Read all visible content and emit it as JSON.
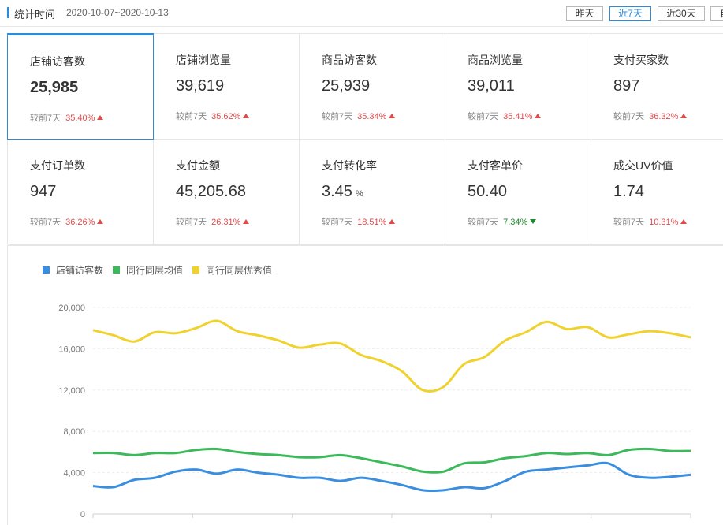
{
  "header": {
    "title": "统计时间",
    "date_range": "2020-10-07~2020-10-13",
    "buttons": [
      {
        "label": "昨天",
        "active": false
      },
      {
        "label": "近7天",
        "active": true
      },
      {
        "label": "近30天",
        "active": false
      },
      {
        "label": "自",
        "active": false
      }
    ]
  },
  "metrics": [
    {
      "label": "店铺访客数",
      "value": "25,985",
      "compare_label": "较前7天",
      "pct": "35.40%",
      "direction": "up",
      "selected": true
    },
    {
      "label": "店铺浏览量",
      "value": "39,619",
      "compare_label": "较前7天",
      "pct": "35.62%",
      "direction": "up"
    },
    {
      "label": "商品访客数",
      "value": "25,939",
      "compare_label": "较前7天",
      "pct": "35.34%",
      "direction": "up"
    },
    {
      "label": "商品浏览量",
      "value": "39,011",
      "compare_label": "较前7天",
      "pct": "35.41%",
      "direction": "up"
    },
    {
      "label": "支付买家数",
      "value": "897",
      "compare_label": "较前7天",
      "pct": "36.32%",
      "direction": "up"
    },
    {
      "label": "支付订单数",
      "value": "947",
      "compare_label": "较前7天",
      "pct": "36.26%",
      "direction": "up"
    },
    {
      "label": "支付金额",
      "value": "45,205.68",
      "compare_label": "较前7天",
      "pct": "26.31%",
      "direction": "up"
    },
    {
      "label": "支付转化率",
      "value": "3.45",
      "unit": "%",
      "compare_label": "较前7天",
      "pct": "18.51%",
      "direction": "up"
    },
    {
      "label": "支付客单价",
      "value": "50.40",
      "compare_label": "较前7天",
      "pct": "7.34%",
      "direction": "down"
    },
    {
      "label": "成交UV价值",
      "value": "1.74",
      "compare_label": "较前7天",
      "pct": "10.31%",
      "direction": "up"
    }
  ],
  "colors": {
    "accent": "#2e8bd8",
    "up": "#e24a4a",
    "down": "#1d8a2b",
    "series_blue": "#3a8ee0",
    "series_green": "#3cb95a",
    "series_yellow": "#f0d22e"
  },
  "chart_data": {
    "type": "line",
    "title": "",
    "xlabel": "",
    "ylabel": "",
    "ylim": [
      0,
      20000
    ],
    "yticks": [
      "0",
      "4,000",
      "8,000",
      "12,000",
      "16,000",
      "20,000"
    ],
    "ytick_values": [
      0,
      4000,
      8000,
      12000,
      16000,
      20000
    ],
    "grid": true,
    "legend": "top-left",
    "series": [
      {
        "name": "店铺访客数",
        "color": "#3a8ee0",
        "values": [
          2700,
          2600,
          3300,
          3500,
          4100,
          4300,
          3900,
          4300,
          4000,
          3800,
          3500,
          3500,
          3200,
          3500,
          3200,
          2800,
          2300,
          2300,
          2600,
          2500,
          3200,
          4100,
          4300,
          4500,
          4700,
          4900,
          3800,
          3500,
          3600,
          3800
        ]
      },
      {
        "name": "同行同层均值",
        "color": "#3cb95a",
        "values": [
          5900,
          5900,
          5700,
          5900,
          5900,
          6200,
          6300,
          6000,
          5800,
          5700,
          5500,
          5500,
          5700,
          5400,
          5000,
          4600,
          4100,
          4100,
          4900,
          5000,
          5400,
          5600,
          5900,
          5800,
          5900,
          5700,
          6200,
          6300,
          6100,
          6100
        ]
      },
      {
        "name": "同行同层优秀值",
        "color": "#f0d22e",
        "values": [
          17800,
          17300,
          16700,
          17600,
          17500,
          18000,
          18700,
          17700,
          17300,
          16800,
          16100,
          16400,
          16500,
          15400,
          14800,
          13800,
          12000,
          12300,
          14500,
          15200,
          16800,
          17600,
          18600,
          17900,
          18100,
          17100,
          17400,
          17700,
          17500,
          17100
        ]
      }
    ]
  }
}
